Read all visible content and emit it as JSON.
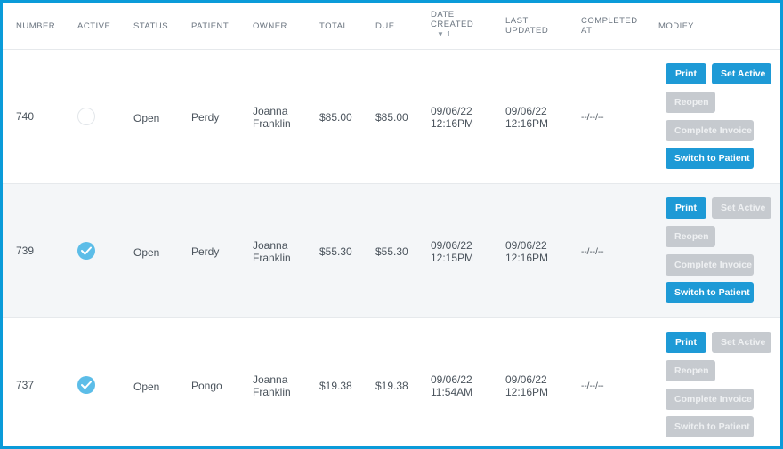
{
  "columns": {
    "number": "NUMBER",
    "active": "ACTIVE",
    "status": "STATUS",
    "patient": "PATIENT",
    "owner": "OWNER",
    "total": "TOTAL",
    "due": "DUE",
    "date_created_1": "DATE",
    "date_created_2": "CREATED",
    "date_created_sort": "▼ 1",
    "last_updated_1": "LAST",
    "last_updated_2": "UPDATED",
    "completed_at_1": "COMPLETED",
    "completed_at_2": "AT",
    "modify": "MODIFY"
  },
  "rows": [
    {
      "number": "740",
      "active": false,
      "status": "Open",
      "patient": "Perdy",
      "owner_first": "Joanna",
      "owner_last": "Franklin",
      "total": "$85.00",
      "due": "$85.00",
      "created_date": "09/06/22",
      "created_time": "12:16PM",
      "updated_date": "09/06/22",
      "updated_time": "12:16PM",
      "completed": "--/--/--",
      "buttons": {
        "print": "Print",
        "set_active": "Set Active",
        "reopen": "Reopen",
        "complete": "Complete Invoice",
        "switch": "Switch to Patient"
      }
    },
    {
      "number": "739",
      "active": true,
      "status": "Open",
      "patient": "Perdy",
      "owner_first": "Joanna",
      "owner_last": "Franklin",
      "total": "$55.30",
      "due": "$55.30",
      "created_date": "09/06/22",
      "created_time": "12:15PM",
      "updated_date": "09/06/22",
      "updated_time": "12:16PM",
      "completed": "--/--/--",
      "buttons": {
        "print": "Print",
        "set_active": "Set Active",
        "reopen": "Reopen",
        "complete": "Complete Invoice",
        "switch": "Switch to Patient"
      }
    },
    {
      "number": "737",
      "active": true,
      "status": "Open",
      "patient": "Pongo",
      "owner_first": "Joanna",
      "owner_last": "Franklin",
      "total": "$19.38",
      "due": "$19.38",
      "created_date": "09/06/22",
      "created_time": "11:54AM",
      "updated_date": "09/06/22",
      "updated_time": "12:16PM",
      "completed": "--/--/--",
      "buttons": {
        "print": "Print",
        "set_active": "Set Active",
        "reopen": "Reopen",
        "complete": "Complete Invoice",
        "switch": "Switch to Patient"
      }
    }
  ],
  "colors": {
    "accent": "#1e9ad6",
    "border": "#0a9bd9",
    "disabled": "#c6cacf",
    "check": "#5cbde8"
  },
  "icons": {
    "sort": "sort-down-icon",
    "active": "checkmark-circle-icon"
  }
}
